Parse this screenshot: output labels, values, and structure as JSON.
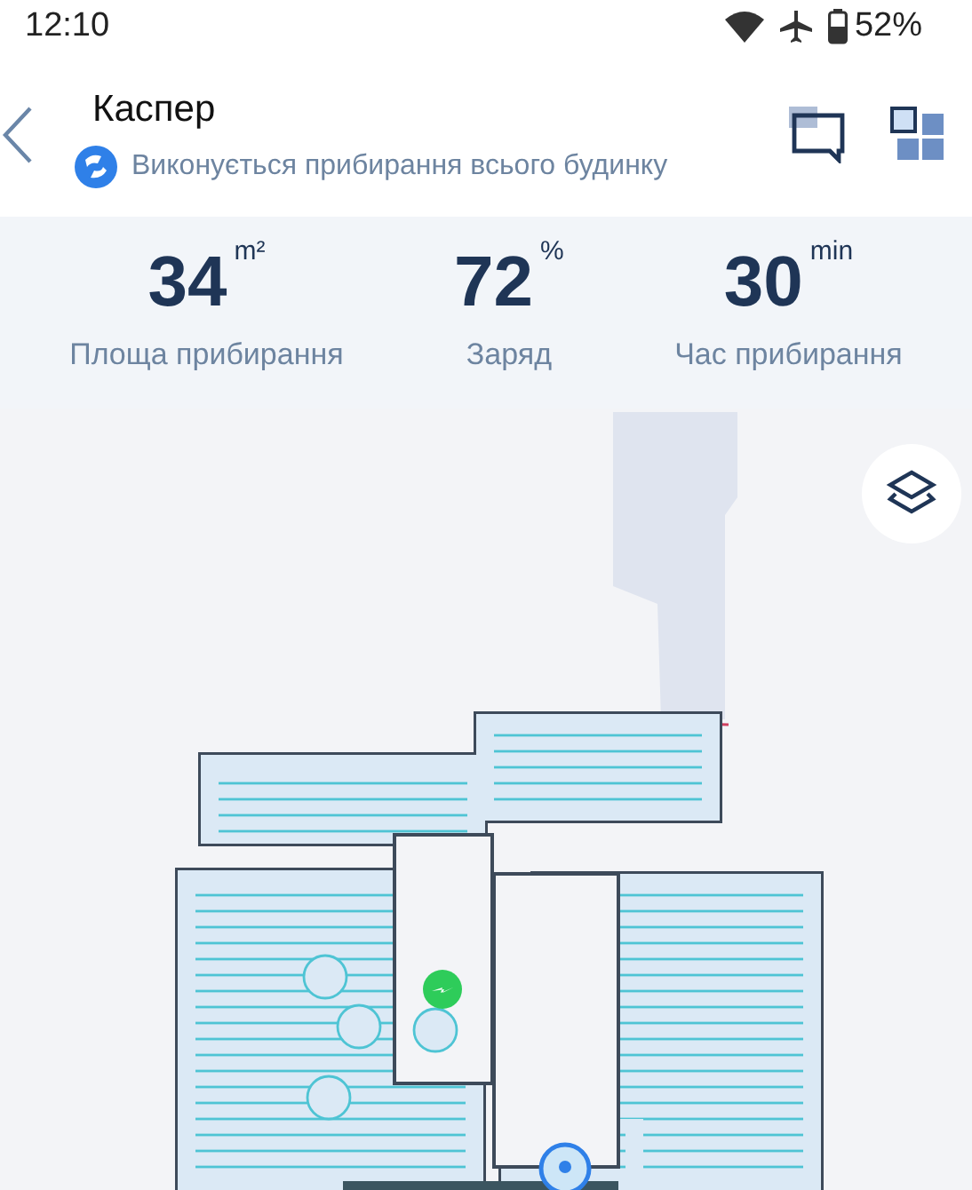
{
  "status_bar": {
    "time": "12:10",
    "battery": "52%"
  },
  "header": {
    "title": "Каспер",
    "status": "Виконується прибирання всього будинку"
  },
  "stats": [
    {
      "value": "34",
      "unit": "m²",
      "label": "Площа прибирання"
    },
    {
      "value": "72",
      "unit": "%",
      "label": "Заряд"
    },
    {
      "value": "30",
      "unit": "min",
      "label": "Час прибирання"
    }
  ],
  "map": {
    "kind": "floor-map"
  }
}
